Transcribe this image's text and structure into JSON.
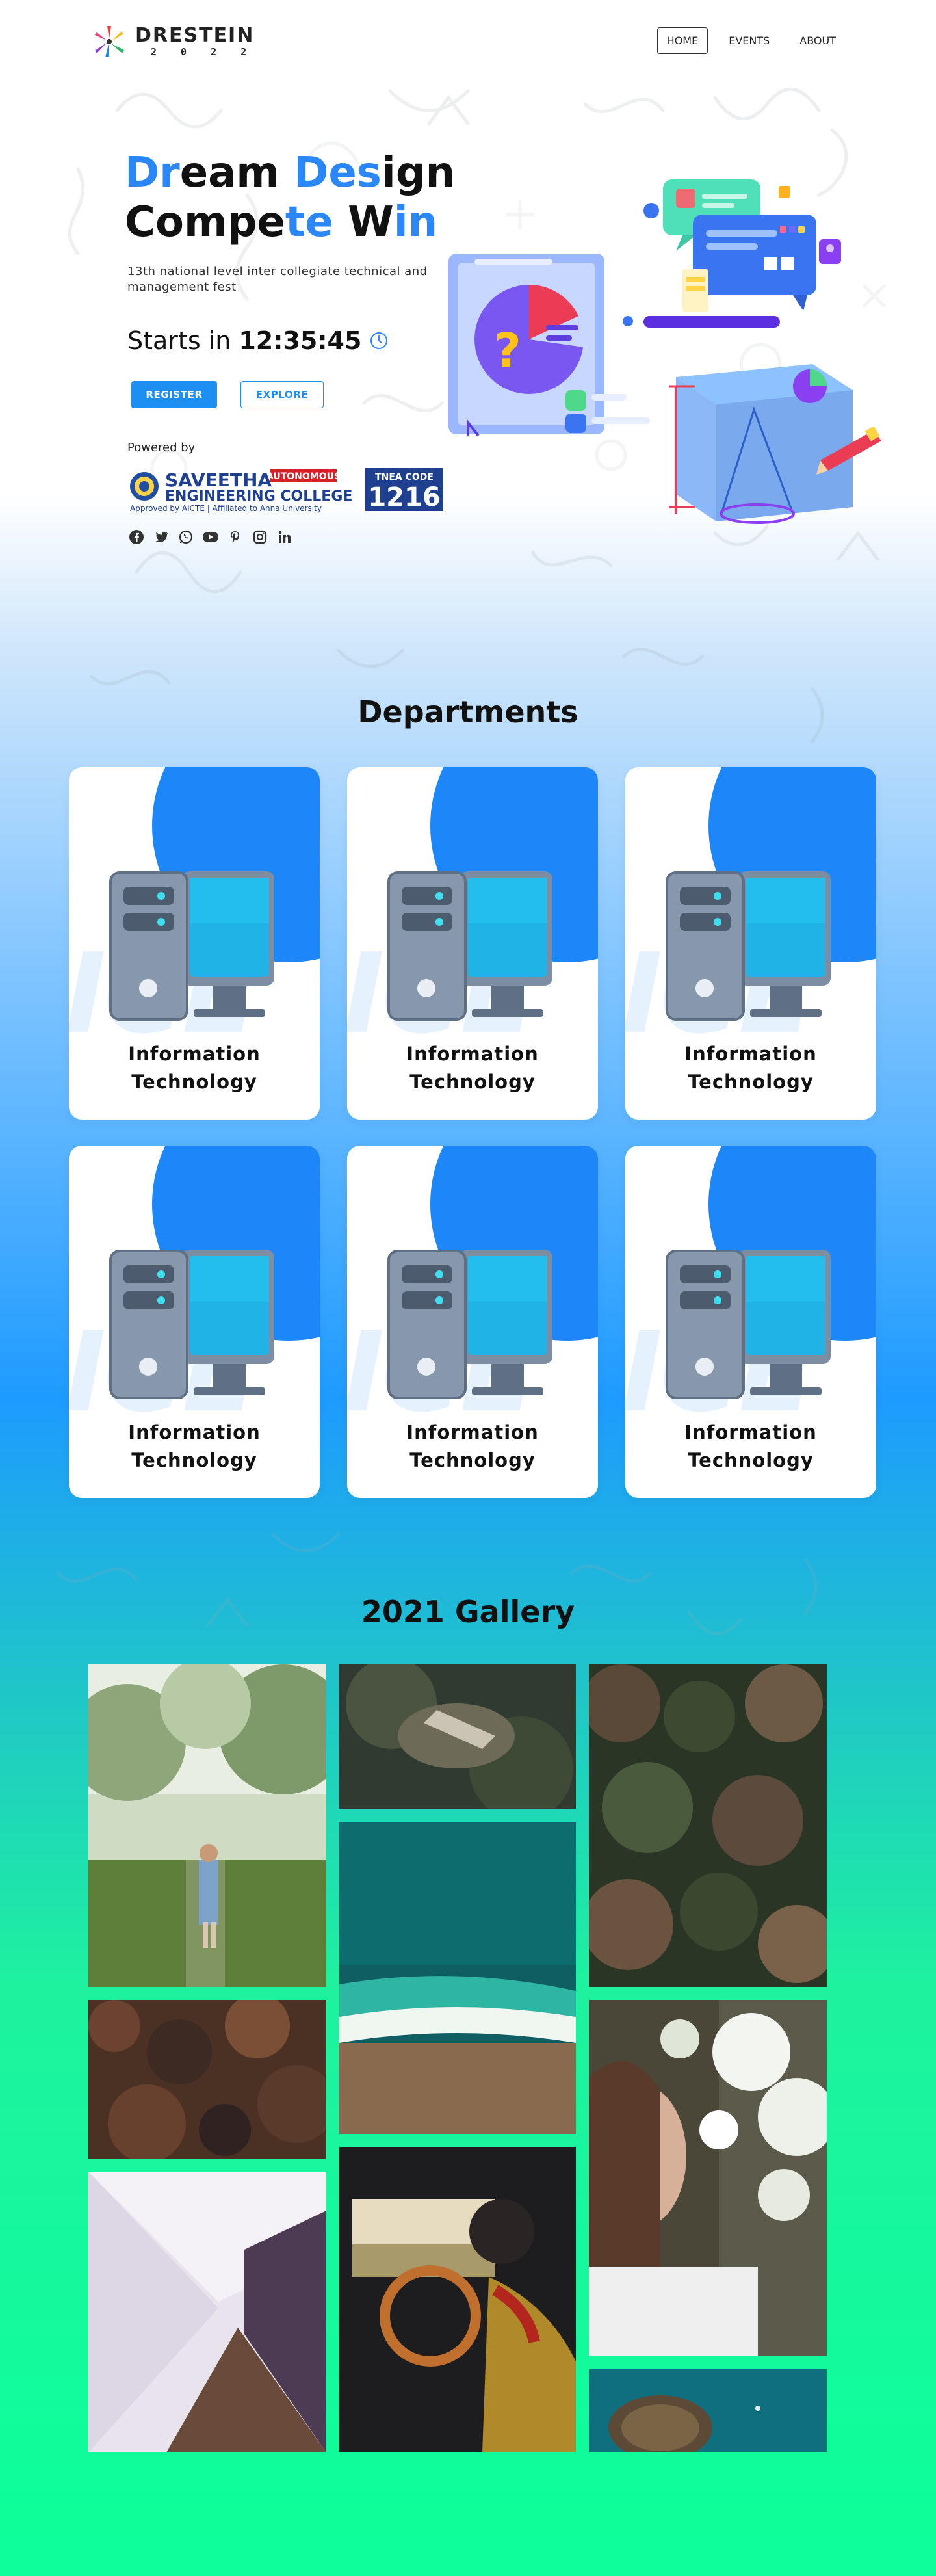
{
  "brand": {
    "name": "DRESTEIN",
    "year": "2 0 2 2"
  },
  "nav": {
    "items": [
      "HOME",
      "EVENTS",
      "ABOUT"
    ],
    "active": "HOME"
  },
  "hero": {
    "title_line1_parts": [
      "Dr",
      "eam ",
      "De",
      "s",
      "ign"
    ],
    "title_line2_parts": [
      "Compe",
      "te",
      " W",
      "in"
    ],
    "subtitle": "13th national level inter collegiate technical and management fest",
    "countdown_label": "Starts in",
    "countdown_time": "12:35:45",
    "register_label": "REGISTER",
    "explore_label": "EXPLORE",
    "powered_by": "Powered by"
  },
  "sponsor": {
    "college_line1": "SAVEETHA",
    "college_line2": "ENGINEERING COLLEGE",
    "autonomous": "AUTONOMOUS",
    "approval": "Approved by AICTE | Affiliated to Anna University",
    "code_label": "TNEA CODE",
    "code_value": "1216"
  },
  "social_icons": [
    "facebook-icon",
    "twitter-icon",
    "whatsapp-icon",
    "youtube-icon",
    "pinterest-icon",
    "instagram-icon",
    "linkedin-icon"
  ],
  "departments": {
    "title": "Departments",
    "cards": [
      {
        "name_line1": "Information",
        "name_line2": "Technology"
      },
      {
        "name_line1": "Information",
        "name_line2": "Technology"
      },
      {
        "name_line1": "Information",
        "name_line2": "Technology"
      },
      {
        "name_line1": "Information",
        "name_line2": "Technology"
      },
      {
        "name_line1": "Information",
        "name_line2": "Technology"
      },
      {
        "name_line1": "Information",
        "name_line2": "Technology"
      }
    ]
  },
  "gallery": {
    "title": "2021 Gallery",
    "photos": [
      "woman-in-orchard",
      "aerial-forest-clearing",
      "aerial-pine-forest",
      "aerial-autumn-forest",
      "aerial-ocean-beach",
      "woman-with-blossoms",
      "white-tunnel",
      "driver-in-car",
      "aerial-ocean-rock"
    ]
  },
  "colors": {
    "accent": "#2b87f7",
    "button": "#1d8ff3",
    "card_circle": "#1d86f8",
    "bottom_green": "#0cff9a"
  }
}
